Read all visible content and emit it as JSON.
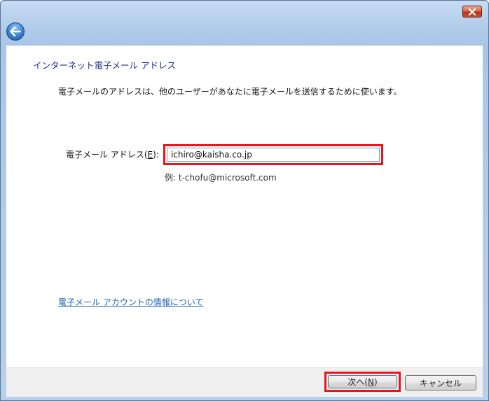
{
  "window": {
    "close_icon": "close-icon",
    "back_icon": "back-arrow-icon",
    "title": "インターネット電子メール アドレス",
    "description": "電子メールのアドレスは、他のユーザーがあなたに電子メールを送信するために使います。"
  },
  "email": {
    "label_prefix": "電子メール アドレス(",
    "label_accel": "E",
    "label_suffix": "):",
    "value": "ichiro@kaisha.co.jp",
    "example": "例: t-chofu@microsoft.com"
  },
  "link": {
    "account_info": "電子メール アカウントの情報について"
  },
  "footer": {
    "next_prefix": "次へ(",
    "next_accel": "N",
    "next_suffix": ")",
    "cancel_label": "キャンセル"
  },
  "colors": {
    "highlight": "#e8151a",
    "title_text": "#1e3287",
    "link": "#1c63b5"
  }
}
